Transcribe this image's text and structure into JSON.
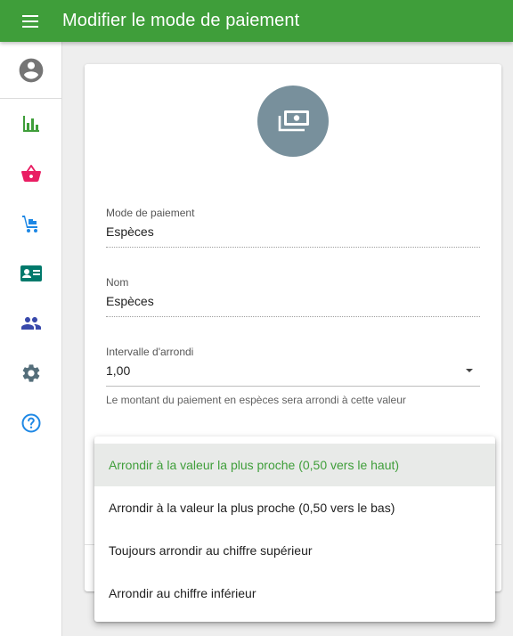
{
  "header": {
    "title": "Modifier le mode de paiement",
    "menu_icon": "menu-icon"
  },
  "colors": {
    "primary": "#3f9e3a",
    "card_icon_bg": "#78909c",
    "basket": "#e91e63",
    "blue": "#1e88e5",
    "teal": "#00796b",
    "indigo": "#3949ab",
    "settings": "#546e7a",
    "help": "#1e88e5"
  },
  "sidebar": {
    "items": [
      {
        "name": "account",
        "icon": "account-circle-icon"
      },
      {
        "name": "stats",
        "icon": "bar-chart-icon"
      },
      {
        "name": "basket",
        "icon": "basket-icon"
      },
      {
        "name": "delivery",
        "icon": "hand-truck-icon"
      },
      {
        "name": "contact",
        "icon": "contact-card-icon"
      },
      {
        "name": "people",
        "icon": "people-icon"
      },
      {
        "name": "settings",
        "icon": "gear-icon"
      },
      {
        "name": "help",
        "icon": "help-icon"
      }
    ]
  },
  "card": {
    "icon": "cash-icon",
    "payment_mode": {
      "label": "Mode de paiement",
      "value": "Espèces"
    },
    "name": {
      "label": "Nom",
      "value": "Espèces"
    },
    "rounding_interval": {
      "label": "Intervalle d'arrondi",
      "value": "1,00",
      "helper": "Le montant du paiement en espèces sera arrondi à cette valeur"
    }
  },
  "dropdown": {
    "options": [
      "Arrondir à la valeur la plus proche (0,50 vers le haut)",
      "Arrondir à la valeur la plus proche (0,50 vers le bas)",
      "Toujours arrondir au chiffre supérieur",
      "Arrondir au chiffre inférieur"
    ],
    "selected": "Arrondir à la valeur la plus proche (0,50 vers le haut)"
  }
}
